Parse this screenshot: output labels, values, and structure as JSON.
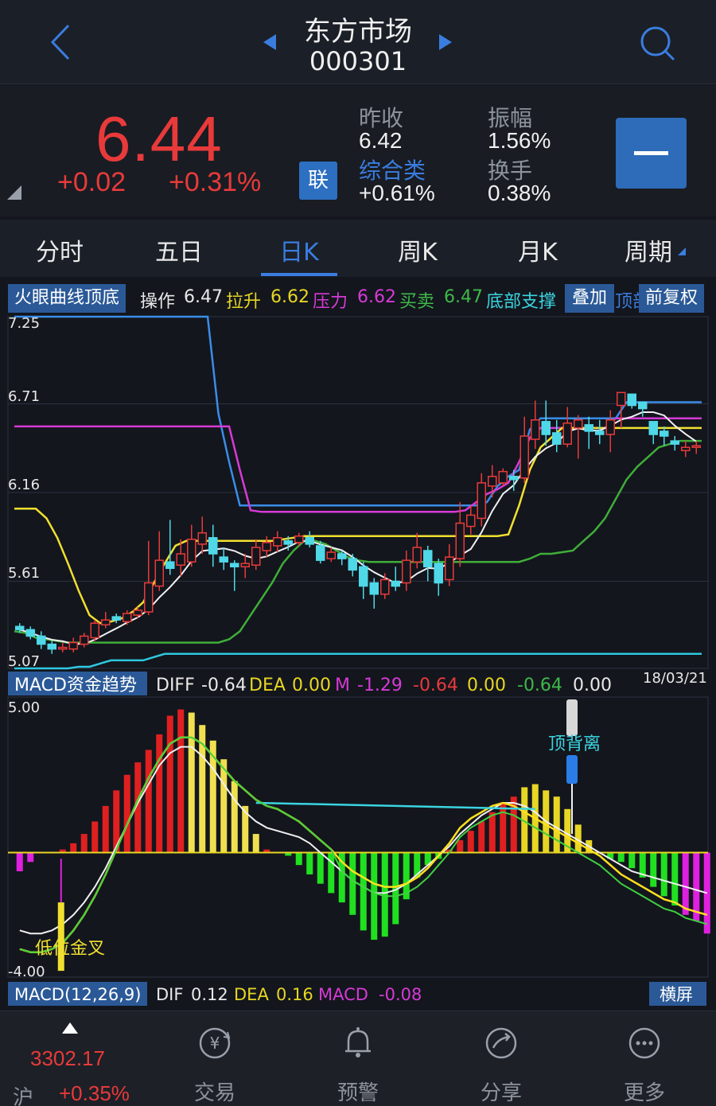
{
  "header": {
    "title": "东方市场",
    "code": "000301"
  },
  "quote": {
    "price": "6.44",
    "change": "+0.02",
    "change_pct": "+0.31%",
    "lian_label": "联",
    "stats": {
      "prev_close_label": "昨收",
      "prev_close": "6.42",
      "amplitude_label": "振幅",
      "amplitude": "1.56%",
      "sector_label": "综合类",
      "sector_change": "+0.61%",
      "turnover_label": "换手",
      "turnover": "0.38%"
    }
  },
  "tabs": [
    "分时",
    "五日",
    "日K",
    "周K",
    "月K",
    "周期"
  ],
  "active_tab": "日K",
  "indicator1": {
    "name": "火眼曲线顶底",
    "op_label": "操作",
    "op_value": "6.47",
    "lift_label": "拉升",
    "lift_value": "6.62",
    "press_label": "压力",
    "press_value": "6.62",
    "trade_label": "买卖",
    "trade_value": "6.47",
    "support_label": "底部支撑",
    "overlay_label": "叠加",
    "overlay_tail": "顶部",
    "adjust_label": "前复权"
  },
  "indicator2": {
    "name": "MACD资金趋势",
    "diff_label": "DIFF",
    "diff_value": "-0.64",
    "dea_label": "DEA",
    "dea_value": "0.00",
    "m_label": "M",
    "m_value": "-1.29",
    "v1": "-0.64",
    "v2": "0.00",
    "v3": "-0.64",
    "v4": "0.00",
    "date": "18/03/21"
  },
  "indicator3": {
    "name": "MACD(12,26,9)",
    "dif_label": "DIF",
    "dif_value": "0.12",
    "dea_label": "DEA",
    "dea_value": "0.16",
    "macd_label": "MACD",
    "macd_value": "-0.08",
    "landscape_label": "横屏"
  },
  "chart_data": {
    "type": "candlestick",
    "price_axis": [
      "7.25",
      "6.71",
      "6.16",
      "5.61",
      "5.07"
    ],
    "ylim": [
      5.07,
      7.25
    ],
    "macd_axis": [
      "5.00",
      "-4.00"
    ],
    "macd_ylim": [
      -4.0,
      5.0
    ],
    "annotations": {
      "bottom_cross": "低位金叉",
      "top_divergence": "顶背离"
    },
    "candles": [
      [
        5.33,
        5.31,
        5.35,
        5.29
      ],
      [
        5.31,
        5.27,
        5.33,
        5.25
      ],
      [
        5.27,
        5.22,
        5.3,
        5.19
      ],
      [
        5.22,
        5.19,
        5.24,
        5.16
      ],
      [
        5.19,
        5.2,
        5.23,
        5.17
      ],
      [
        5.19,
        5.23,
        5.26,
        5.17
      ],
      [
        5.22,
        5.27,
        5.29,
        5.2
      ],
      [
        5.26,
        5.35,
        5.37,
        5.24
      ],
      [
        5.34,
        5.37,
        5.42,
        5.32
      ],
      [
        5.39,
        5.37,
        5.41,
        5.35
      ],
      [
        5.36,
        5.41,
        5.43,
        5.34
      ],
      [
        5.4,
        5.43,
        5.45,
        5.38
      ],
      [
        5.42,
        5.6,
        5.86,
        5.4
      ],
      [
        5.58,
        5.74,
        5.92,
        5.55
      ],
      [
        5.73,
        5.69,
        5.99,
        5.65
      ],
      [
        5.71,
        5.78,
        5.87,
        5.64
      ],
      [
        5.73,
        5.87,
        5.96,
        5.7
      ],
      [
        5.84,
        5.91,
        6.01,
        5.78
      ],
      [
        5.88,
        5.78,
        5.96,
        5.7
      ],
      [
        5.76,
        5.73,
        5.82,
        5.68
      ],
      [
        5.72,
        5.7,
        5.74,
        5.55
      ],
      [
        5.7,
        5.72,
        5.78,
        5.63
      ],
      [
        5.71,
        5.82,
        5.87,
        5.68
      ],
      [
        5.8,
        5.85,
        5.89,
        5.76
      ],
      [
        5.83,
        5.88,
        5.92,
        5.79
      ],
      [
        5.86,
        5.84,
        5.89,
        5.8
      ],
      [
        5.85,
        5.89,
        5.91,
        5.83
      ],
      [
        5.88,
        5.84,
        5.92,
        5.82
      ],
      [
        5.83,
        5.74,
        5.86,
        5.72
      ],
      [
        5.75,
        5.79,
        5.82,
        5.73
      ],
      [
        5.78,
        5.75,
        5.8,
        5.71
      ],
      [
        5.75,
        5.68,
        5.78,
        5.64
      ],
      [
        5.7,
        5.58,
        5.73,
        5.5
      ],
      [
        5.6,
        5.53,
        5.63,
        5.44
      ],
      [
        5.53,
        5.62,
        5.66,
        5.5
      ],
      [
        5.61,
        5.58,
        5.7,
        5.55
      ],
      [
        5.6,
        5.74,
        5.8,
        5.55
      ],
      [
        5.73,
        5.82,
        5.91,
        5.69
      ],
      [
        5.8,
        5.7,
        5.83,
        5.61
      ],
      [
        5.72,
        5.6,
        5.75,
        5.52
      ],
      [
        5.62,
        5.76,
        5.84,
        5.58
      ],
      [
        5.75,
        5.97,
        6.1,
        5.7
      ],
      [
        5.95,
        6.02,
        6.08,
        5.9
      ],
      [
        6.0,
        6.22,
        6.28,
        5.95
      ],
      [
        6.2,
        6.26,
        6.33,
        6.13
      ],
      [
        6.22,
        6.29,
        6.31,
        6.2
      ],
      [
        6.26,
        6.24,
        6.3,
        6.17
      ],
      [
        6.25,
        6.51,
        6.63,
        6.22
      ],
      [
        6.49,
        6.61,
        6.73,
        6.43
      ],
      [
        6.6,
        6.52,
        6.73,
        6.45
      ],
      [
        6.53,
        6.46,
        6.61,
        6.41
      ],
      [
        6.46,
        6.59,
        6.69,
        6.44
      ],
      [
        6.56,
        6.61,
        6.64,
        6.37
      ],
      [
        6.58,
        6.54,
        6.63,
        6.43
      ],
      [
        6.54,
        6.52,
        6.61,
        6.46
      ],
      [
        6.52,
        6.61,
        6.67,
        6.41
      ],
      [
        6.7,
        6.78,
        6.78,
        6.56
      ],
      [
        6.77,
        6.7,
        6.77,
        6.68
      ],
      [
        6.72,
        6.68,
        6.7,
        6.63
      ],
      [
        6.6,
        6.52,
        6.58,
        6.46
      ],
      [
        6.54,
        6.51,
        6.57,
        6.45
      ],
      [
        6.48,
        6.46,
        6.51,
        6.42
      ],
      [
        6.42,
        6.44,
        6.48,
        6.38
      ],
      [
        6.44,
        6.45,
        6.48,
        6.4
      ]
    ],
    "lines": {
      "blue": [
        7.25,
        7.25,
        7.25,
        7.25,
        7.25,
        7.25,
        7.25,
        7.25,
        7.25,
        7.25,
        7.25,
        7.25,
        7.25,
        7.25,
        7.25,
        7.25,
        7.25,
        7.25,
        7.25,
        6.65,
        6.35,
        6.08,
        6.08,
        6.08,
        6.08,
        6.08,
        6.08,
        6.08,
        6.08,
        6.08,
        6.08,
        6.08,
        6.08,
        6.08,
        6.08,
        6.08,
        6.08,
        6.08,
        6.08,
        6.08,
        6.08,
        6.08,
        6.08,
        6.08,
        6.1,
        6.2,
        6.26,
        6.3,
        6.55,
        6.62,
        6.62,
        6.62,
        6.62,
        6.62,
        6.62,
        6.62,
        6.62,
        6.72,
        6.72,
        6.72,
        6.72,
        6.72,
        6.72,
        6.72,
        6.72
      ],
      "magenta": [
        6.57,
        6.57,
        6.57,
        6.57,
        6.57,
        6.57,
        6.57,
        6.57,
        6.57,
        6.57,
        6.57,
        6.57,
        6.57,
        6.57,
        6.57,
        6.57,
        6.57,
        6.57,
        6.57,
        6.57,
        6.57,
        6.3,
        6.05,
        6.04,
        6.04,
        6.04,
        6.04,
        6.04,
        6.04,
        6.04,
        6.04,
        6.04,
        6.04,
        6.04,
        6.04,
        6.04,
        6.04,
        6.04,
        6.04,
        6.04,
        6.04,
        6.04,
        6.05,
        6.1,
        6.15,
        6.18,
        6.22,
        6.35,
        6.5,
        6.56,
        6.56,
        6.56,
        6.56,
        6.56,
        6.56,
        6.56,
        6.62,
        6.62,
        6.62,
        6.62,
        6.62,
        6.62,
        6.62,
        6.62,
        6.62
      ],
      "yellow": [
        6.06,
        6.06,
        6.06,
        6.0,
        5.88,
        5.72,
        5.55,
        5.4,
        5.35,
        5.36,
        5.38,
        5.42,
        5.48,
        5.6,
        5.72,
        5.83,
        5.86,
        5.86,
        5.86,
        5.86,
        5.86,
        5.86,
        5.86,
        5.86,
        5.86,
        5.87,
        5.88,
        5.89,
        5.89,
        5.89,
        5.89,
        5.89,
        5.89,
        5.89,
        5.89,
        5.89,
        5.89,
        5.89,
        5.89,
        5.89,
        5.89,
        5.89,
        5.89,
        5.89,
        5.89,
        5.89,
        5.9,
        6.08,
        6.3,
        6.44,
        6.5,
        6.56,
        6.56,
        6.56,
        6.56,
        6.56,
        6.56,
        6.56,
        6.56,
        6.56,
        6.56,
        6.56,
        6.56,
        6.56,
        6.56
      ],
      "green": [
        5.3,
        5.29,
        5.26,
        5.25,
        5.24,
        5.23,
        5.23,
        5.23,
        5.23,
        5.23,
        5.23,
        5.23,
        5.23,
        5.23,
        5.23,
        5.23,
        5.23,
        5.23,
        5.23,
        5.23,
        5.25,
        5.3,
        5.4,
        5.5,
        5.6,
        5.72,
        5.8,
        5.86,
        5.86,
        5.84,
        5.8,
        5.76,
        5.74,
        5.73,
        5.73,
        5.73,
        5.73,
        5.73,
        5.73,
        5.73,
        5.73,
        5.73,
        5.73,
        5.73,
        5.73,
        5.73,
        5.73,
        5.73,
        5.75,
        5.78,
        5.78,
        5.79,
        5.8,
        5.86,
        5.92,
        6.0,
        6.12,
        6.24,
        6.32,
        6.38,
        6.44,
        6.46,
        6.48,
        6.48,
        6.48
      ],
      "cyan": [
        5.07,
        5.07,
        5.07,
        5.07,
        5.07,
        5.07,
        5.08,
        5.08,
        5.1,
        5.12,
        5.12,
        5.12,
        5.12,
        5.14,
        5.16,
        5.16,
        5.16,
        5.16,
        5.16,
        5.16,
        5.16,
        5.16,
        5.16,
        5.16,
        5.16,
        5.16,
        5.16,
        5.16,
        5.16,
        5.16,
        5.16,
        5.16,
        5.16,
        5.16,
        5.16,
        5.16,
        5.16,
        5.16,
        5.16,
        5.16,
        5.16,
        5.16,
        5.16,
        5.16,
        5.16,
        5.16,
        5.16,
        5.16,
        5.16,
        5.16,
        5.16,
        5.16,
        5.16,
        5.16,
        5.16,
        5.16,
        5.16,
        5.16,
        5.16,
        5.16,
        5.16,
        5.16,
        5.16,
        5.16,
        5.16
      ]
    },
    "macd_bars": [
      -0.6,
      -0.3,
      0.0,
      0.0,
      0.1,
      0.3,
      0.6,
      1.0,
      1.5,
      2.0,
      2.5,
      2.9,
      3.3,
      3.8,
      4.4,
      4.6,
      4.5,
      4.1,
      3.6,
      3.0,
      2.3,
      1.5,
      0.6,
      0.1,
      0.0,
      -0.1,
      -0.4,
      -0.7,
      -1.0,
      -1.3,
      -1.6,
      -2.0,
      -2.5,
      -2.8,
      -2.7,
      -2.3,
      -1.5,
      -0.8,
      -0.4,
      -0.2,
      0.1,
      0.4,
      0.7,
      1.0,
      1.3,
      1.6,
      1.8,
      2.1,
      2.2,
      2.0,
      1.8,
      1.4,
      0.9,
      0.4,
      0.0,
      -0.2,
      -0.3,
      -0.5,
      -0.8,
      -1.1,
      -1.4,
      -1.7,
      -2.0,
      -2.2,
      -2.6
    ],
    "macd_signal": [
      -2.5,
      -2.6,
      -2.6,
      -2.5,
      -2.3,
      -2.0,
      -1.6,
      -1.1,
      -0.5,
      0.2,
      0.9,
      1.6,
      2.2,
      2.8,
      3.2,
      3.4,
      3.4,
      3.1,
      2.7,
      2.2,
      1.7,
      1.3,
      1.0,
      0.8,
      0.7,
      0.6,
      0.5,
      0.3,
      0.0,
      -0.3,
      -0.6,
      -0.9,
      -1.1,
      -1.3,
      -1.3,
      -1.2,
      -1.0,
      -0.7,
      -0.4,
      -0.1,
      0.2,
      0.6,
      0.9,
      1.2,
      1.4,
      1.6,
      1.6,
      1.5,
      1.3,
      1.0,
      0.8,
      0.6,
      0.4,
      0.2,
      0.0,
      -0.2,
      -0.4,
      -0.6,
      -0.7,
      -0.8,
      -0.9,
      -1.0,
      -1.1,
      -1.2,
      -1.3
    ],
    "macd_fast": [
      -3.1,
      -3.2,
      -3.2,
      -3.1,
      -2.9,
      -2.5,
      -2.0,
      -1.4,
      -0.7,
      0.1,
      0.9,
      1.7,
      2.4,
      3.0,
      3.5,
      3.7,
      3.7,
      3.5,
      3.1,
      2.7,
      2.3,
      2.0,
      1.7,
      1.5,
      1.4,
      1.2,
      1.0,
      0.7,
      0.4,
      0.1,
      -0.3,
      -0.6,
      -0.8,
      -1.0,
      -1.1,
      -1.1,
      -1.0,
      -0.8,
      -0.5,
      -0.1,
      0.3,
      0.8,
      1.1,
      1.3,
      1.5,
      1.6,
      1.5,
      1.3,
      1.1,
      0.9,
      0.7,
      0.5,
      0.3,
      0.1,
      -0.1,
      -0.4,
      -0.7,
      -0.9,
      -1.1,
      -1.3,
      -1.5,
      -1.6,
      -1.8,
      -1.9,
      -2.0
    ],
    "macd_top": [
      0.0,
      0.0,
      0.0,
      0.0,
      0.0,
      0.0,
      0.0,
      0.0,
      0.0,
      0.0,
      0.0,
      0.0,
      0.0,
      0.0,
      0.0,
      0.0,
      0.0,
      0.0,
      0.0,
      0.0,
      0.0,
      0.0,
      0.0,
      0.0,
      0.0,
      0.0,
      0.0,
      0.0,
      0.0,
      0.0,
      0.0,
      0.0,
      0.0,
      0.0,
      0.0,
      0.0,
      0.0,
      0.0,
      0.0,
      0.0,
      0.0,
      0.0,
      0.0,
      0.0,
      0.0,
      0.0,
      0.0,
      0.0,
      0.0,
      0.0,
      0.0,
      0.0,
      0.0,
      0.0,
      0.0,
      0.0,
      0.0,
      0.0,
      0.0,
      0.0,
      0.0,
      0.0,
      0.0,
      0.0,
      0.0
    ]
  },
  "bottom_nav": {
    "index_value": "3302.17",
    "index_name": "沪",
    "index_pct": "+0.35%",
    "items": [
      "交易",
      "预警",
      "分享",
      "更多"
    ]
  }
}
